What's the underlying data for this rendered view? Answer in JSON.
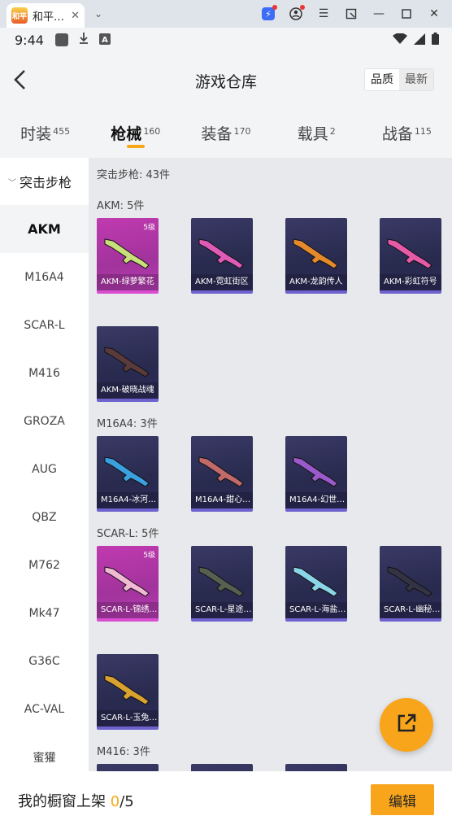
{
  "window": {
    "tab_title": "和平…",
    "tab_logo_text": "和平"
  },
  "status_bar": {
    "time": "9:44"
  },
  "header": {
    "title": "游戏仓库",
    "sort_quality": "品质",
    "sort_latest": "最新"
  },
  "categories": [
    {
      "label": "时装",
      "count": "455"
    },
    {
      "label": "枪械",
      "count": "160"
    },
    {
      "label": "装备",
      "count": "170"
    },
    {
      "label": "载具",
      "count": "2"
    },
    {
      "label": "战备",
      "count": "115"
    }
  ],
  "sidebar": {
    "group": "突击步枪",
    "items": [
      "AKM",
      "M16A4",
      "SCAR-L",
      "M416",
      "GROZA",
      "AUG",
      "QBZ",
      "M762",
      "Mk47",
      "G36C",
      "AC-VAL",
      "蜜獾"
    ]
  },
  "main": {
    "group_summary": "突击步枪: 43件",
    "sections": [
      {
        "title": "AKM: 5件",
        "items": [
          {
            "name": "AKM-绿萝繁花",
            "level": "5级",
            "rarity": "pink",
            "gun_color": "#c9e07a"
          },
          {
            "name": "AKM-霓虹街区",
            "level": "",
            "rarity": "purple",
            "gun_color": "#e05ab8"
          },
          {
            "name": "AKM-龙韵传人",
            "level": "",
            "rarity": "purple",
            "gun_color": "#e48a2c"
          },
          {
            "name": "AKM-彩虹符号",
            "level": "",
            "rarity": "purple",
            "gun_color": "#e75aa8"
          },
          {
            "name": "AKM-破晓战魂",
            "level": "",
            "rarity": "purple",
            "gun_color": "#5a3a3a"
          }
        ]
      },
      {
        "title": "M16A4: 3件",
        "items": [
          {
            "name": "M16A4-冰河…",
            "level": "",
            "rarity": "purple",
            "gun_color": "#3aa0e0"
          },
          {
            "name": "M16A4-甜心…",
            "level": "",
            "rarity": "purple",
            "gun_color": "#c06a6a"
          },
          {
            "name": "M16A4-幻世…",
            "level": "",
            "rarity": "purple",
            "gun_color": "#9b5acb"
          }
        ]
      },
      {
        "title": "SCAR-L: 5件",
        "items": [
          {
            "name": "SCAR-L-锦绣…",
            "level": "5级",
            "rarity": "pink",
            "gun_color": "#f2b9d4"
          },
          {
            "name": "SCAR-L-星途…",
            "level": "",
            "rarity": "purple",
            "gun_color": "#556050"
          },
          {
            "name": "SCAR-L-海盐…",
            "level": "",
            "rarity": "purple",
            "gun_color": "#8ad6e8"
          },
          {
            "name": "SCAR-L-幽秘…",
            "level": "",
            "rarity": "purple",
            "gun_color": "#333344"
          },
          {
            "name": "SCAR-L-玉兔…",
            "level": "",
            "rarity": "purple",
            "gun_color": "#d9a230"
          }
        ]
      },
      {
        "title": "M416: 3件",
        "items": []
      }
    ]
  },
  "bottom_bar": {
    "label": "我的橱窗上架 ",
    "current": "0",
    "total": "/5",
    "edit_button": "编辑"
  },
  "colors": {
    "accent": "#f9a51c",
    "pink_card": "#b43cb2",
    "purple_card": "#2d2a57"
  }
}
